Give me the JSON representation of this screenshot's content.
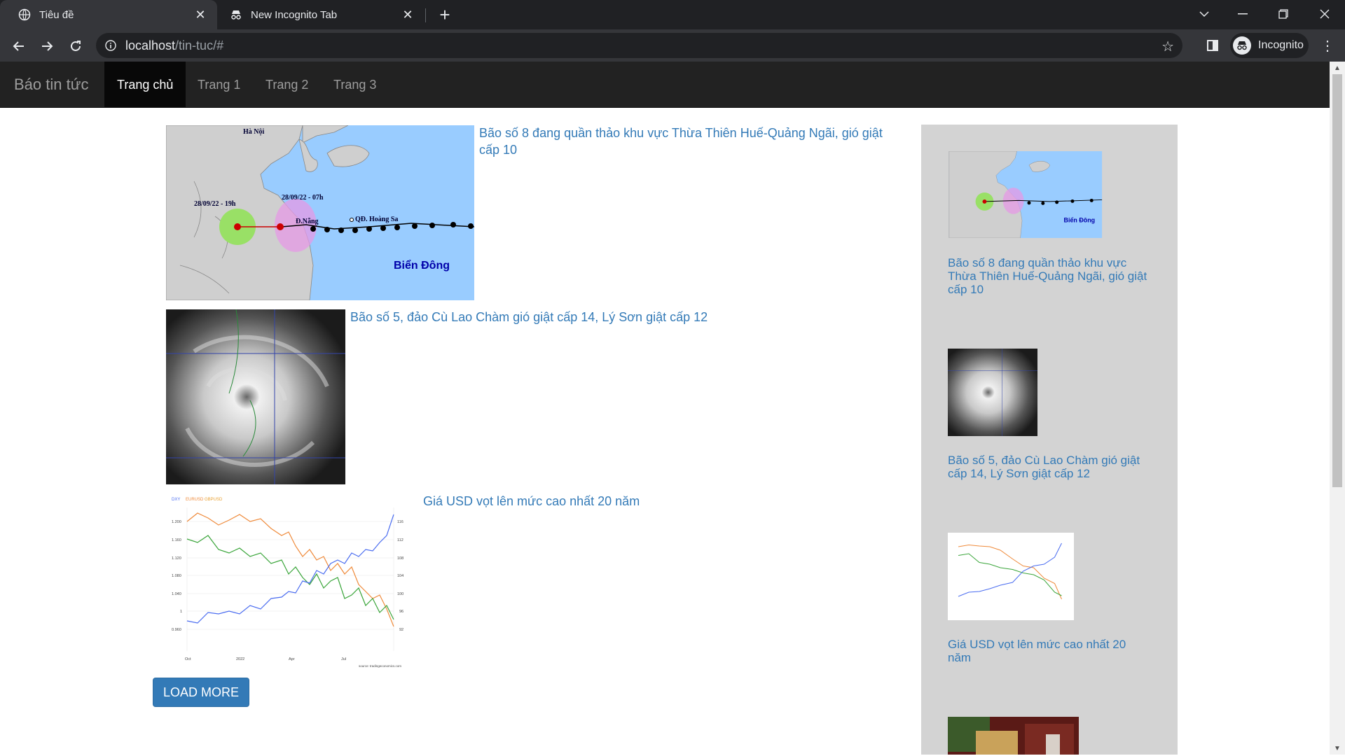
{
  "browser": {
    "tabs": [
      {
        "title": "Tiêu đề",
        "icon": "globe-icon",
        "active": true
      },
      {
        "title": "New Incognito Tab",
        "icon": "incognito-icon",
        "active": false
      }
    ],
    "url_host": "localhost",
    "url_path": "/tin-tuc/#",
    "profile_label": "Incognito"
  },
  "site": {
    "brand": "Báo tin tức",
    "nav": [
      {
        "label": "Trang chủ",
        "active": true
      },
      {
        "label": "Trang 1",
        "active": false
      },
      {
        "label": "Trang 2",
        "active": false
      },
      {
        "label": "Trang 3",
        "active": false
      }
    ]
  },
  "articles": [
    {
      "title": "Bão số 8 đang quần thảo khu vực Thừa Thiên Huế-Quảng Ngãi, gió giật cấp 10",
      "image": "storm-track-map"
    },
    {
      "title": "Bão số 5, đảo Cù Lao Chàm gió giật cấp 14, Lý Sơn giật cấp 12",
      "image": "satellite-storm"
    },
    {
      "title": "Giá USD vọt lên mức cao nhất 20 năm",
      "image": "usd-chart"
    }
  ],
  "map_labels": {
    "hanoi": "Hà Nội",
    "date1": "28/09/22 - 19h",
    "date2": "28/09/22 - 07h",
    "danang": "Đ.Nẵng",
    "hoangsa": "QĐ. Hoàng Sa",
    "biendong": "Biển Đông"
  },
  "usd_chart": {
    "legend": [
      "DXY",
      "EURUSD",
      "GBPUSD"
    ],
    "left_ticks": [
      "1.200",
      "1.160",
      "1.120",
      "1.080",
      "1.040",
      "1",
      "0.960"
    ],
    "right_ticks": [
      "116",
      "112",
      "108",
      "104",
      "100",
      "96",
      "92"
    ],
    "x_ticks": [
      "Oct",
      "2022",
      "Apr",
      "Jul"
    ],
    "source": "source: tradingeconomics.com"
  },
  "load_more_label": "LOAD MORE",
  "sidebar": [
    {
      "title": "Bão số 8 đang quần thảo khu vực Thừa Thiên Huế-Quảng Ngãi, gió giật cấp 10"
    },
    {
      "title": "Bão số 5, đảo Cù Lao Chàm gió giật cấp 14, Lý Sơn giật cấp 12"
    },
    {
      "title": "Giá USD vọt lên mức cao nhất 20 năm"
    },
    {
      "title": ""
    }
  ],
  "colors": {
    "link": "#337ab7",
    "navbar": "#222222",
    "sidebar_bg": "#d3d3d3",
    "sea": "#99ccff"
  }
}
